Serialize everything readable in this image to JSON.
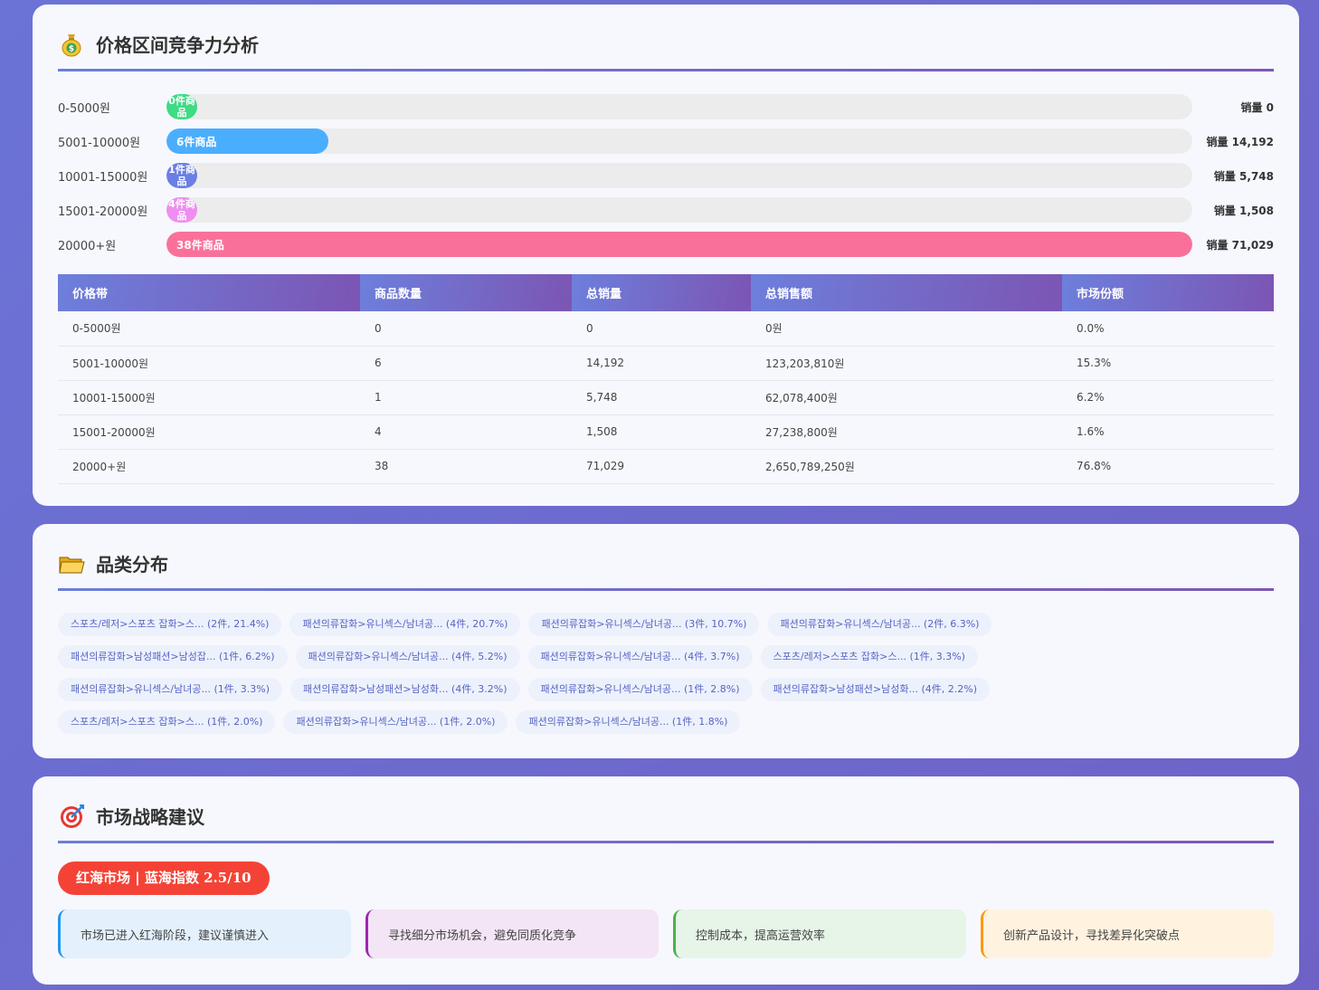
{
  "price_section": {
    "title": "价格区间竞争力分析",
    "icon": "money-bag-icon",
    "bars": [
      {
        "label": "0-5000원",
        "fill_text": "0件商品",
        "fraction": 0.0,
        "color": "#3ddc84",
        "sales": "销量 0"
      },
      {
        "label": "5001-10000원",
        "fill_text": "6件商品",
        "fraction": 0.1579,
        "color": "#4aaeff",
        "sales": "销量 14,192"
      },
      {
        "label": "10001-15000원",
        "fill_text": "1件商品",
        "fraction": 0.0263,
        "color": "#6a7fe6",
        "sales": "销量 5,748"
      },
      {
        "label": "15001-20000원",
        "fill_text": "4件商品",
        "fraction": 0.0,
        "color": "#ee8ef0",
        "sales": "销量 1,508"
      },
      {
        "label": "20000+원",
        "fill_text": "38件商品",
        "fraction": 1.0,
        "color": "#f9719a",
        "sales": "销量 71,029"
      }
    ],
    "table": {
      "headers": [
        "价格带",
        "商品数量",
        "总销量",
        "总销售额",
        "市场份额"
      ],
      "rows": [
        [
          "0-5000원",
          "0",
          "0",
          "0원",
          "0.0%"
        ],
        [
          "5001-10000원",
          "6",
          "14,192",
          "123,203,810원",
          "15.3%"
        ],
        [
          "10001-15000원",
          "1",
          "5,748",
          "62,078,400원",
          "6.2%"
        ],
        [
          "15001-20000원",
          "4",
          "1,508",
          "27,238,800원",
          "1.6%"
        ],
        [
          "20000+원",
          "38",
          "71,029",
          "2,650,789,250원",
          "76.8%"
        ]
      ]
    }
  },
  "category_section": {
    "title": "品类分布",
    "icon": "folder-icon",
    "tags": [
      "스포츠/레저>스포츠 잡화>스... (2件, 21.4%)",
      "패션의류잡화>유니섹스/남녀공... (4件, 20.7%)",
      "패션의류잡화>유니섹스/남녀공... (3件, 10.7%)",
      "패션의류잡화>유니섹스/남녀공... (2件, 6.3%)",
      "패션의류잡화>남성패션>남성잡... (1件, 6.2%)",
      "패션의류잡화>유니섹스/남녀공... (4件, 5.2%)",
      "패션의류잡화>유니섹스/남녀공... (4件, 3.7%)",
      "스포츠/레저>스포츠 잡화>스... (1件, 3.3%)",
      "패션의류잡화>유니섹스/남녀공... (1件, 3.3%)",
      "패션의류잡화>남성패션>남성화... (4件, 3.2%)",
      "패션의류잡화>유니섹스/남녀공... (1件, 2.8%)",
      "패션의류잡화>남성패션>남성화... (4件, 2.2%)",
      "스포츠/레저>스포츠 잡화>스... (1件, 2.0%)",
      "패션의류잡화>유니섹스/남녀공... (1件, 2.0%)",
      "패션의류잡화>유니섹스/남녀공... (1件, 1.8%)"
    ]
  },
  "strategy_section": {
    "title": "市场战略建议",
    "icon": "target-icon",
    "badge": "红海市场 | 蓝海指数 2.5/10",
    "tips": [
      "市场已进入红海阶段，建议谨慎进入",
      "寻找细分市场机会，避免同质化竞争",
      "控制成本，提高运营效率",
      "创新产品设计，寻找差异化突破点"
    ]
  }
}
